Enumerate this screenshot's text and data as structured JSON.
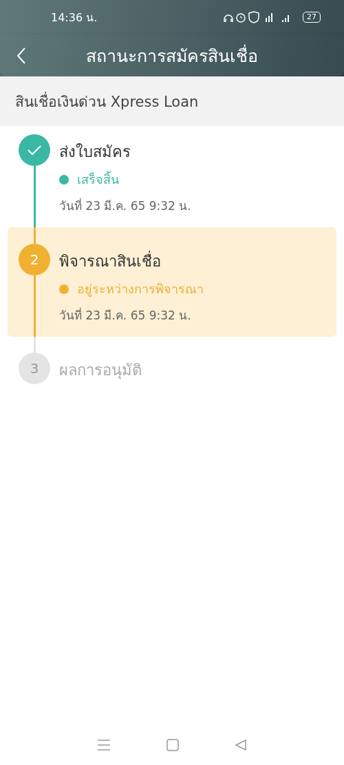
{
  "status_bar": {
    "time": "14:36 น.",
    "battery": "27"
  },
  "header": {
    "title": "สถานะการสมัครสินเชื่อ"
  },
  "section": {
    "title": "สินเชื่อเงินด่วน Xpress Loan"
  },
  "steps": [
    {
      "kind": "done",
      "title": "ส่งใบสมัคร",
      "status": "เสร็จสิ้น",
      "date": "วันที่ 23 มี.ค. 65 9:32 น."
    },
    {
      "kind": "current",
      "number": "2",
      "title": "พิจารณาสินเชื่อ",
      "status": "อยู่ระหว่างการพิจารณา",
      "date": "วันที่ 23 มี.ค. 65 9:32 น."
    },
    {
      "kind": "pending",
      "number": "3",
      "title": "ผลการอนุมัติ"
    }
  ]
}
